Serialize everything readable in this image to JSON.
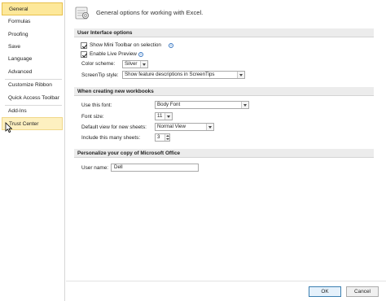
{
  "sidebar": {
    "items": [
      {
        "label": "General",
        "state": "active"
      },
      {
        "label": "Formulas",
        "state": ""
      },
      {
        "label": "Proofing",
        "state": ""
      },
      {
        "label": "Save",
        "state": ""
      },
      {
        "label": "Language",
        "state": ""
      },
      {
        "label": "Advanced",
        "state": ""
      },
      {
        "label": "Customize Ribbon",
        "state": ""
      },
      {
        "label": "Quick Access Toolbar",
        "state": ""
      },
      {
        "label": "Add-Ins",
        "state": ""
      },
      {
        "label": "Trust Center",
        "state": "hover"
      }
    ]
  },
  "header": {
    "title": "General options for working with Excel.",
    "icon": "options-icon"
  },
  "ui_options": {
    "section_title": "User Interface options",
    "show_mini_toolbar": {
      "label": "Show Mini Toolbar on selection",
      "checked": true
    },
    "enable_live_preview": {
      "label": "Enable Live Preview",
      "checked": true
    },
    "color_scheme": {
      "label": "Color scheme:",
      "value": "Silver"
    },
    "screentip_style": {
      "label": "ScreenTip style:",
      "value": "Show feature descriptions in ScreenTips"
    }
  },
  "new_workbooks": {
    "section_title": "When creating new workbooks",
    "font": {
      "label": "Use this font:",
      "value": "Body Font"
    },
    "font_size": {
      "label": "Font size:",
      "value": "11"
    },
    "default_view": {
      "label": "Default view for new sheets:",
      "value": "Normal View"
    },
    "sheets": {
      "label": "Include this many sheets:",
      "value": "3"
    }
  },
  "personalize": {
    "section_title": "Personalize your copy of Microsoft Office",
    "user_name": {
      "label": "User name:",
      "value": "Dell"
    }
  },
  "footer": {
    "ok_label": "OK",
    "cancel_label": "Cancel"
  },
  "colors": {
    "active_nav": "#fde89a",
    "section_bar": "#ececec",
    "ok_border": "#3c7fb1"
  }
}
